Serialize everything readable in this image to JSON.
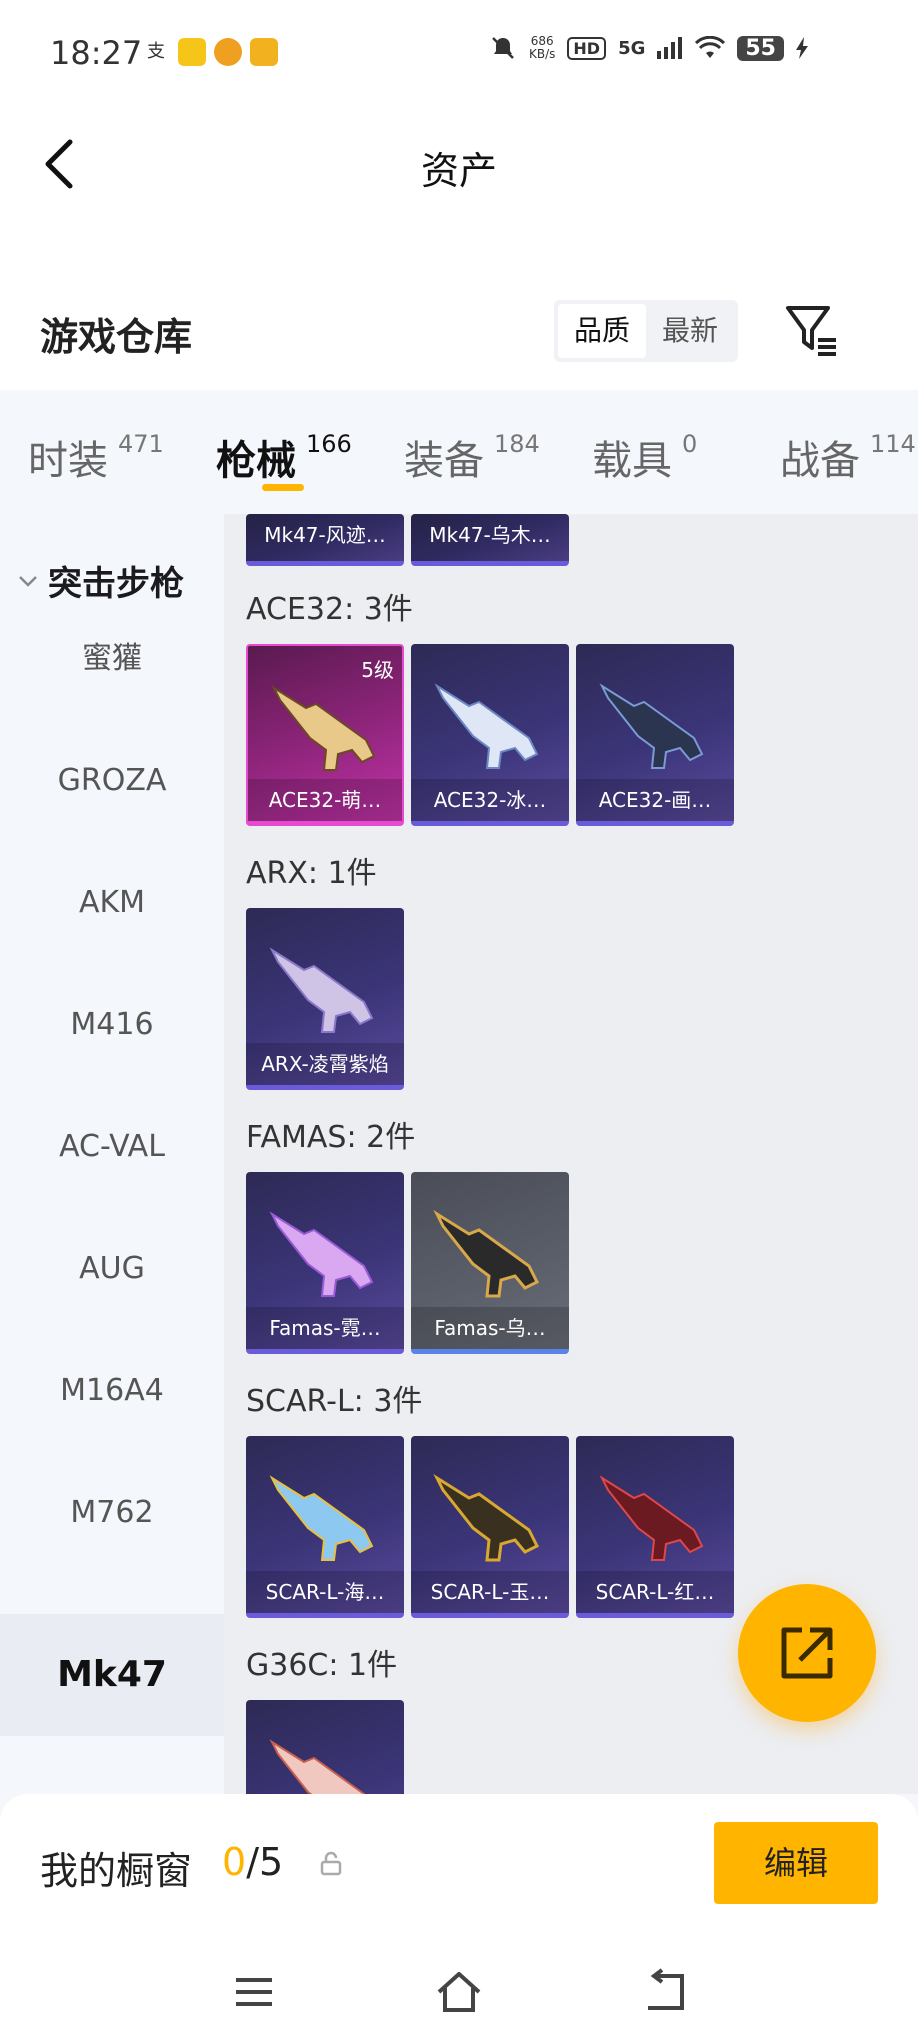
{
  "status_bar": {
    "time": "18:27",
    "app_icons": [
      "alipay-icon",
      "app-icon-1",
      "app-icon-2",
      "app-icon-3"
    ],
    "net_speed": "686",
    "net_speed_unit": "KB/s",
    "hd": "HD",
    "signal": "5G",
    "battery": "55"
  },
  "header": {
    "title": "资产"
  },
  "warehouse": {
    "title": "游戏仓库",
    "sort_options": [
      "品质",
      "最新"
    ],
    "sort_selected": "品质"
  },
  "tabs": [
    {
      "label": "时装",
      "count": "471"
    },
    {
      "label": "枪械",
      "count": "166",
      "active": true
    },
    {
      "label": "装备",
      "count": "184"
    },
    {
      "label": "载具",
      "count": "0"
    },
    {
      "label": "战备",
      "count": "114"
    }
  ],
  "sidebar": {
    "group": "突击步枪",
    "items": [
      "蜜獾",
      "GROZA",
      "AKM",
      "M416",
      "AC-VAL",
      "AUG",
      "M16A4",
      "M762",
      "Mk47"
    ],
    "active": "Mk47"
  },
  "content": {
    "top_items": [
      "Mk47-风迹…",
      "Mk47-乌木…"
    ],
    "categories": [
      {
        "label": "ACE32: 3件",
        "items": [
          {
            "name": "ACE32-萌…",
            "level": "5级",
            "style": "pink"
          },
          {
            "name": "ACE32-冰…",
            "style": "purple"
          },
          {
            "name": "ACE32-画…",
            "style": "purple"
          }
        ]
      },
      {
        "label": "ARX: 1件",
        "items": [
          {
            "name": "ARX-凌霄紫焰",
            "style": "purple"
          }
        ]
      },
      {
        "label": "FAMAS: 2件",
        "items": [
          {
            "name": "Famas-霓…",
            "style": "purple"
          },
          {
            "name": "Famas-乌…",
            "style": "grey"
          }
        ]
      },
      {
        "label": "SCAR-L: 3件",
        "items": [
          {
            "name": "SCAR-L-海…",
            "style": "purple"
          },
          {
            "name": "SCAR-L-玉…",
            "style": "purple"
          },
          {
            "name": "SCAR-L-红…",
            "style": "purple"
          }
        ]
      },
      {
        "label": "G36C: 1件",
        "items": [
          {
            "name": "",
            "style": "purple"
          }
        ]
      }
    ]
  },
  "fab": {
    "icon": "share-out-icon"
  },
  "showcase": {
    "label": "我的橱窗",
    "current": "0",
    "total": "/5",
    "edit_label": "编辑"
  },
  "colors": {
    "accent": "#ffb400",
    "card_purple": "#3b3578",
    "card_pink": "#c233a8"
  }
}
